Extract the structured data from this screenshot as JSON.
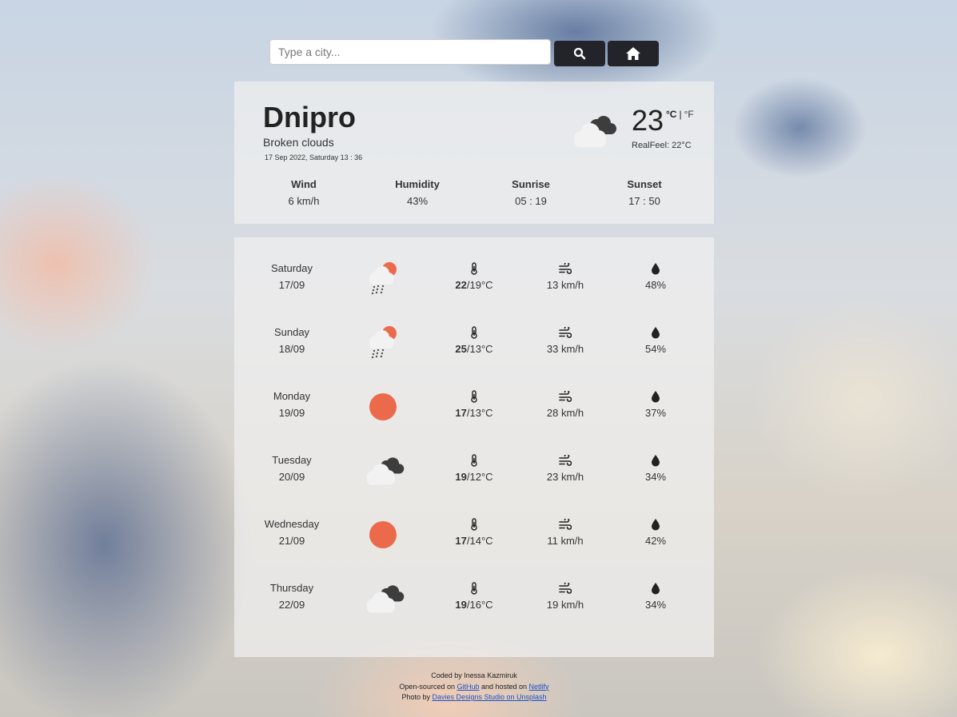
{
  "search": {
    "placeholder": "Type a city..."
  },
  "buttons": {
    "search_icon": "search-icon",
    "home_icon": "home-icon"
  },
  "current": {
    "city": "Dnipro",
    "description": "Broken clouds",
    "date": "17 Sep 2022, Saturday 13 : 36",
    "temperature": "23",
    "unit_c": "°C",
    "unit_sep": "|",
    "unit_f": "°F",
    "realfeel": "RealFeel: 22°C",
    "icon": "broken-clouds-icon",
    "stats": [
      {
        "label": "Wind",
        "value": "6 km/h"
      },
      {
        "label": "Humidity",
        "value": "43%"
      },
      {
        "label": "Sunrise",
        "value": "05 : 19"
      },
      {
        "label": "Sunset",
        "value": "17 : 50"
      }
    ]
  },
  "forecast": [
    {
      "day": "Saturday",
      "date": "17/09",
      "icon": "rain-sun-icon",
      "high": "22",
      "low": "/19°C",
      "wind": "13 km/h",
      "humidity": "48%"
    },
    {
      "day": "Sunday",
      "date": "18/09",
      "icon": "rain-sun-icon",
      "high": "25",
      "low": "/13°C",
      "wind": "33 km/h",
      "humidity": "54%"
    },
    {
      "day": "Monday",
      "date": "19/09",
      "icon": "sun-icon",
      "high": "17",
      "low": "/13°C",
      "wind": "28 km/h",
      "humidity": "37%"
    },
    {
      "day": "Tuesday",
      "date": "20/09",
      "icon": "broken-clouds-icon",
      "high": "19",
      "low": "/12°C",
      "wind": "23 km/h",
      "humidity": "34%"
    },
    {
      "day": "Wednesday",
      "date": "21/09",
      "icon": "sun-icon",
      "high": "17",
      "low": "/14°C",
      "wind": "11 km/h",
      "humidity": "42%"
    },
    {
      "day": "Thursday",
      "date": "22/09",
      "icon": "broken-clouds-icon",
      "high": "19",
      "low": "/16°C",
      "wind": "19 km/h",
      "humidity": "34%"
    }
  ],
  "footer": {
    "line1": "Coded by Inessa Kazmiruk",
    "line2_prefix": "Open-sourced on ",
    "github": "GitHub",
    "line2_middle": " and hosted on ",
    "netlify": "Netlify",
    "line3_prefix": "Photo by ",
    "photo_link": "Davies Designs Studio on Unsplash"
  },
  "colors": {
    "sun": "#ec6a4c",
    "button": "#222429",
    "panel": "#f0f0f0"
  }
}
